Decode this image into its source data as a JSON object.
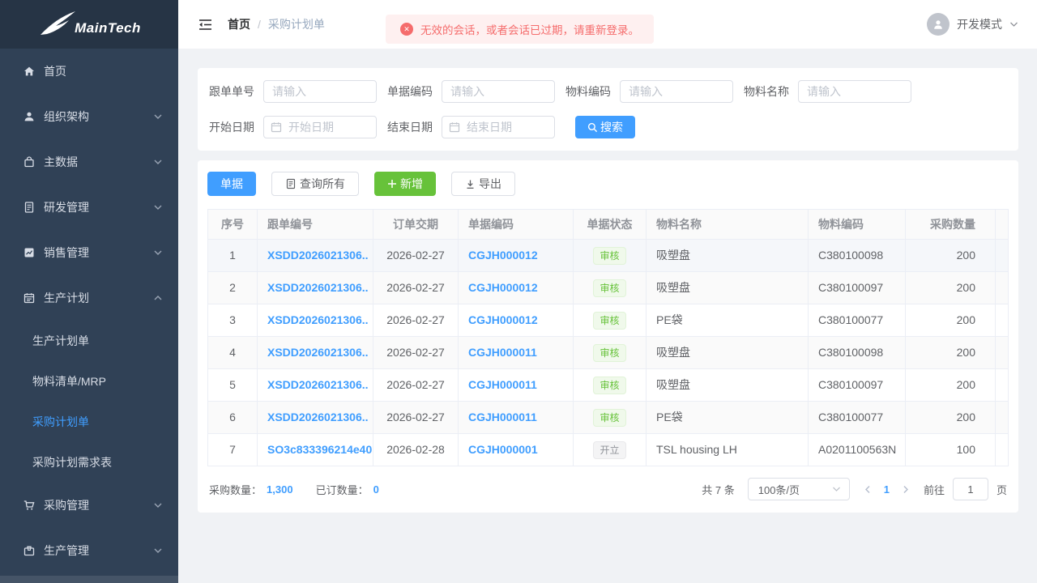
{
  "colors": {
    "accent": "#409eff",
    "success": "#67c23a",
    "danger": "#f56c6c",
    "sidebar_bg": "#304156"
  },
  "sidebar": {
    "logo_text": "MainTech",
    "items": [
      {
        "label": "首页",
        "icon": "home-icon"
      },
      {
        "label": "组织架构",
        "icon": "user-icon"
      },
      {
        "label": "主数据",
        "icon": "shopping-bag-icon"
      },
      {
        "label": "研发管理",
        "icon": "document-icon"
      },
      {
        "label": "销售管理",
        "icon": "chart-icon"
      },
      {
        "label": "生产计划",
        "icon": "calendar-icon",
        "expanded": true
      },
      {
        "label": "采购管理",
        "icon": "cart-icon"
      },
      {
        "label": "生产管理",
        "icon": "package-icon"
      }
    ],
    "submenu": {
      "parent": "生产计划",
      "items": [
        "生产计划单",
        "物料清单/MRP",
        "采购计划单",
        "采购计划需求表"
      ],
      "active": "采购计划单"
    }
  },
  "header": {
    "breadcrumb_root": "首页",
    "breadcrumb_separator": "/",
    "breadcrumb_current": "采购计划单",
    "alert_text": "无效的会话，或者会话已过期，请重新登录。",
    "user_name": "开发模式"
  },
  "filters": {
    "fields": [
      {
        "label": "跟单单号",
        "placeholder": "请输入"
      },
      {
        "label": "单据编码",
        "placeholder": "请输入"
      },
      {
        "label": "物料编码",
        "placeholder": "请输入"
      },
      {
        "label": "物料名称",
        "placeholder": "请输入"
      }
    ],
    "dates": [
      {
        "label": "开始日期",
        "placeholder": "开始日期"
      },
      {
        "label": "结束日期",
        "placeholder": "结束日期"
      }
    ],
    "search_label": "搜索"
  },
  "toolbar": {
    "doc_button": "单据",
    "query_all_button": "查询所有",
    "add_button": "新增",
    "export_button": "导出"
  },
  "table": {
    "columns": [
      "序号",
      "跟单编号",
      "订单交期",
      "单据编码",
      "单据状态",
      "物料名称",
      "物料编码",
      "采购数量"
    ],
    "rows": [
      {
        "no": "1",
        "order": "XSDD2026021306..",
        "due": "2026-02-27",
        "doc": "CGJH000012",
        "status": "审核",
        "status_type": "success",
        "material": "吸塑盘",
        "code": "C380100098",
        "qty": "200",
        "row_bg": "hover"
      },
      {
        "no": "2",
        "order": "XSDD2026021306..",
        "due": "2026-02-27",
        "doc": "CGJH000012",
        "status": "审核",
        "status_type": "success",
        "material": "吸塑盘",
        "code": "C380100097",
        "qty": "200",
        "row_bg": "stripe"
      },
      {
        "no": "3",
        "order": "XSDD2026021306..",
        "due": "2026-02-27",
        "doc": "CGJH000012",
        "status": "审核",
        "status_type": "success",
        "material": "PE袋",
        "code": "C380100077",
        "qty": "200",
        "row_bg": ""
      },
      {
        "no": "4",
        "order": "XSDD2026021306..",
        "due": "2026-02-27",
        "doc": "CGJH000011",
        "status": "审核",
        "status_type": "success",
        "material": "吸塑盘",
        "code": "C380100098",
        "qty": "200",
        "row_bg": "stripe"
      },
      {
        "no": "5",
        "order": "XSDD2026021306..",
        "due": "2026-02-27",
        "doc": "CGJH000011",
        "status": "审核",
        "status_type": "success",
        "material": "吸塑盘",
        "code": "C380100097",
        "qty": "200",
        "row_bg": ""
      },
      {
        "no": "6",
        "order": "XSDD2026021306..",
        "due": "2026-02-27",
        "doc": "CGJH000011",
        "status": "审核",
        "status_type": "success",
        "material": "PE袋",
        "code": "C380100077",
        "qty": "200",
        "row_bg": "stripe"
      },
      {
        "no": "7",
        "order": "SO3c833396214e40",
        "due": "2026-02-28",
        "doc": "CGJH000001",
        "status": "开立",
        "status_type": "info",
        "material": "TSL housing LH",
        "code": "A0201100563N",
        "qty": "100",
        "row_bg": ""
      }
    ]
  },
  "footer": {
    "summary": {
      "purchase_label": "采购数量：",
      "purchase_value": "1,300",
      "ordered_label": "已订数量：",
      "ordered_value": "0"
    },
    "pagination": {
      "total": "共 7 条",
      "page_size": "100条/页",
      "current_page": "1",
      "goto_label": "前往",
      "goto_value": "1",
      "unit_label": "页"
    }
  }
}
